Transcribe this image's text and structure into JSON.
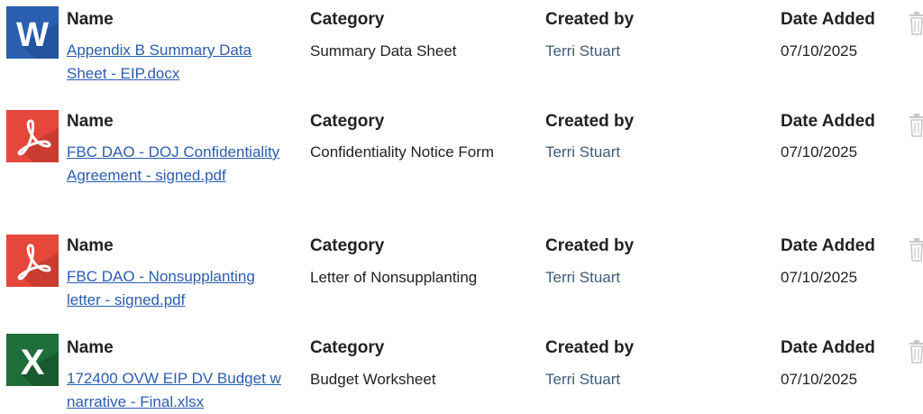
{
  "headers": {
    "name": "Name",
    "category": "Category",
    "created_by": "Created by",
    "date_added": "Date Added"
  },
  "colors": {
    "word": "#2b5fb0",
    "pdf": "#e5473a",
    "excel": "#1e6e3a",
    "link": "#2a5db0",
    "trash": "#c8c8c8"
  },
  "documents": [
    {
      "icon": "word-file-icon",
      "icon_letter": "W",
      "name": "Appendix B Summary Data Sheet - EIP.docx",
      "category": "Summary Data Sheet",
      "created_by": "Terri Stuart",
      "date_added": "07/10/2025"
    },
    {
      "icon": "pdf-file-icon",
      "name": "FBC DAO - DOJ Confidentiality Agreement - signed.pdf",
      "category": "Confidentiality Notice Form",
      "created_by": "Terri Stuart",
      "date_added": "07/10/2025"
    },
    {
      "icon": "pdf-file-icon",
      "name": "FBC DAO - Nonsupplanting letter - signed.pdf",
      "category": "Letter of Nonsupplanting",
      "created_by": "Terri Stuart",
      "date_added": "07/10/2025"
    },
    {
      "icon": "excel-file-icon",
      "icon_letter": "X",
      "name": "172400 OVW EIP DV Budget w narrative - Final.xlsx",
      "category": "Budget Worksheet",
      "created_by": "Terri Stuart",
      "date_added": "07/10/2025"
    }
  ]
}
